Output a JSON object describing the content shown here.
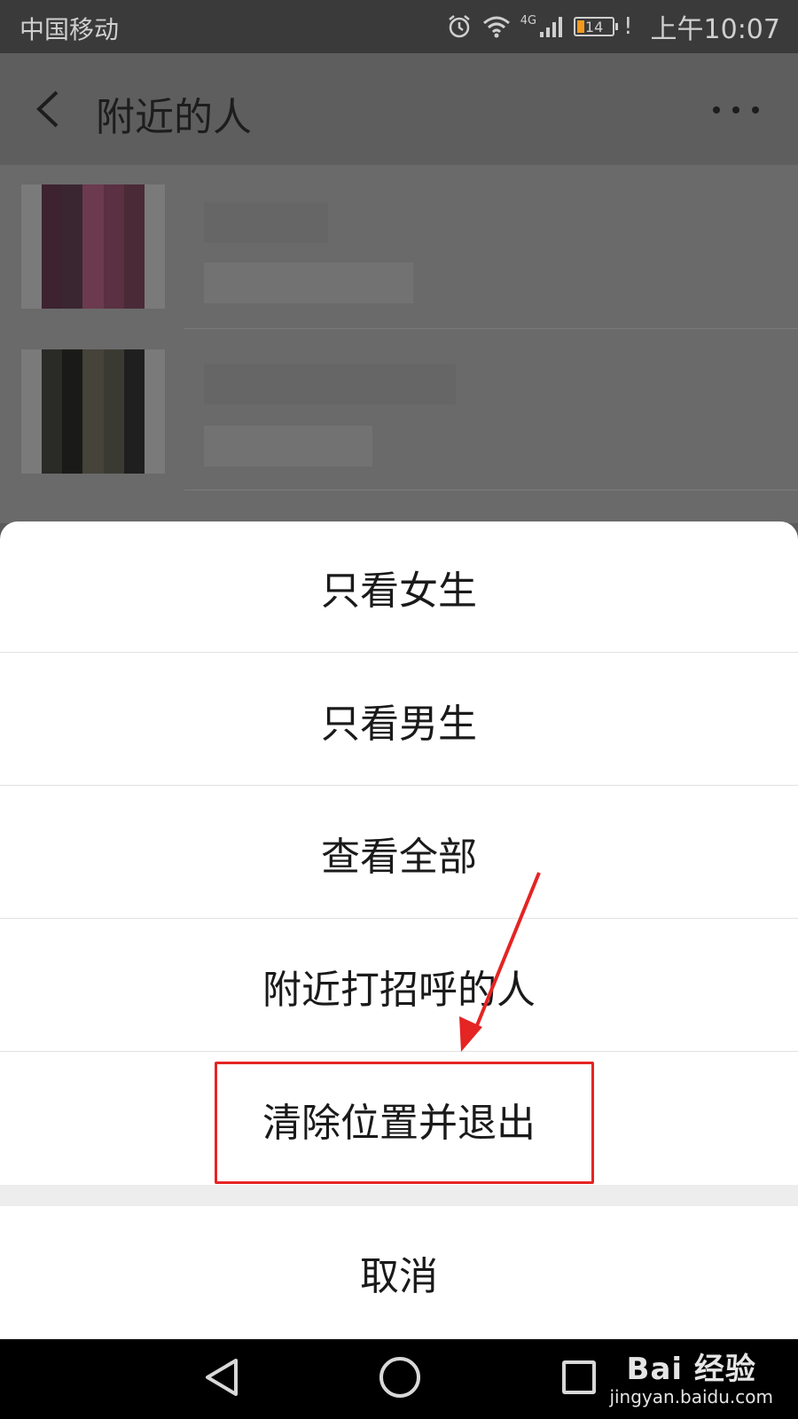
{
  "status_bar": {
    "carrier": "中国移动",
    "network": "4G",
    "battery": "14",
    "alert": "!",
    "time": "上午10:07"
  },
  "nav": {
    "title": "附近的人"
  },
  "action_sheet": {
    "items": [
      {
        "label": "只看女生"
      },
      {
        "label": "只看男生"
      },
      {
        "label": "查看全部"
      },
      {
        "label": "附近打招呼的人"
      },
      {
        "label": "清除位置并退出"
      }
    ],
    "cancel_label": "取消"
  },
  "annotation": {
    "highlight_color": "#e52424"
  },
  "watermark": {
    "brand": "Bai 经验",
    "url": "jingyan.baidu.com"
  },
  "colors": {
    "overlay_dim": "#5b5b5b",
    "sheet_bg": "#ffffff",
    "text": "#1a1a1a"
  }
}
